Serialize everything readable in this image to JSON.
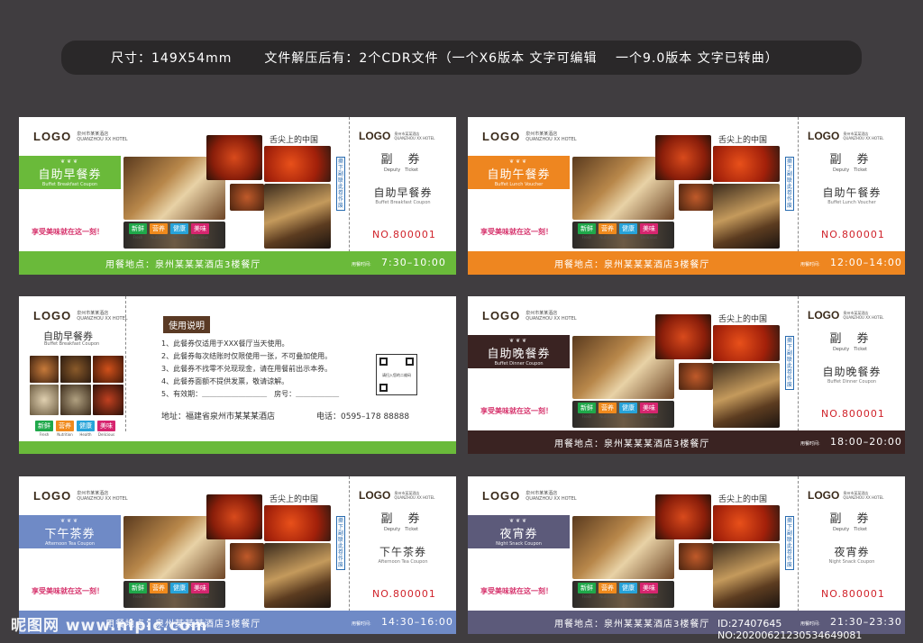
{
  "header": {
    "size": "尺寸：149X54mm",
    "desc": "文件解压后有：2个CDR文件（一个X6版本 文字可编辑　 一个9.0版本 文字已转曲）"
  },
  "common": {
    "logo": "LOGO",
    "hotel_cn": "泉州市某某酒店",
    "hotel_en": "QUANZHOU XX HOTEL",
    "tagline": "舌尖上的中国",
    "slogan": "享受美味就在这一刻！",
    "vertical": "撕下副联此卷作废",
    "fu_cn": "副　券",
    "fu_en": "Deputy　Ticket",
    "number": "NO.800001",
    "venue": "用餐地点：泉州某某某酒店3楼餐厅",
    "time_label": "用餐时间:",
    "badges": [
      {
        "cn": "新鲜",
        "en": "Fresh",
        "color": "#1fa84a"
      },
      {
        "cn": "营养",
        "en": "Nutrition",
        "color": "#f08a1c"
      },
      {
        "cn": "健康",
        "en": "Health",
        "color": "#27a3d9"
      },
      {
        "cn": "美味",
        "en": "Delicious",
        "color": "#d6256f"
      }
    ]
  },
  "tickets": [
    {
      "name_cn": "自助早餐券",
      "name_en": "Buffet Breakfast Coupon",
      "time": "7:30–10:00",
      "color": "#6aba3a"
    },
    {
      "name_cn": "自助午餐券",
      "name_en": "Buffet Lunch Voucher",
      "time": "12:00–14:00",
      "color": "#ee8620"
    },
    {
      "name_cn": "自助晚餐券",
      "name_en": "Buffet Dinner Coupon",
      "time": "18:00–20:00",
      "color": "#3a2322"
    },
    {
      "name_cn": "下午茶券",
      "name_en": "Afternoon Tea Coupon",
      "time": "14:30–16:00",
      "color": "#6f8ac6"
    },
    {
      "name_cn": "夜宵券",
      "name_en": "Night Snack Coupon",
      "time": "21:30–23:30",
      "color": "#5c5a7a"
    }
  ],
  "info": {
    "title": "使用说明",
    "rules": [
      "1、此餐券仅适用于XXX餐厅当天使用。",
      "2、此餐券每次结账时仅限使用一张，不可叠加使用。",
      "3、此餐券不找零不兑现现金，请在用餐前出示本券。",
      "4、此餐券面额不提供发票，敬请谅解。",
      "5、有效期：＿＿＿＿＿＿＿＿＿　房号：＿＿＿＿＿＿"
    ],
    "address": "地址：福建省泉州市某某某酒店",
    "phone": "电话：0595–178 88888",
    "qr_text": "请扫入您的二维码",
    "band_cn": "自助早餐券",
    "band_en": "Buffet Breakfast Coupon",
    "bar_color": "#6aba3a"
  },
  "watermark": {
    "site": "昵图网 www.nipic.com",
    "id": "ID:27407645 NO:20200621230534649081"
  }
}
